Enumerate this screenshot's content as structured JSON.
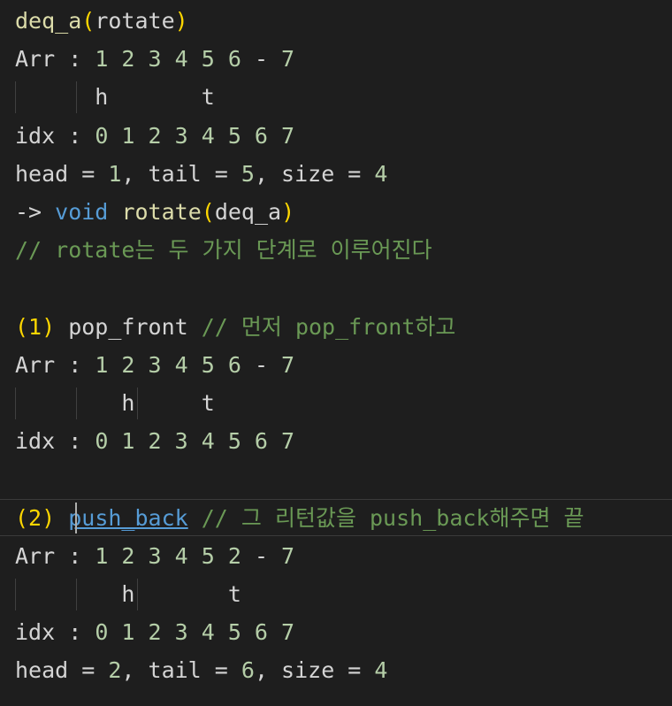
{
  "lines": [
    {
      "parts": [
        {
          "t": "deq_a",
          "c": "yellow"
        },
        {
          "t": "(",
          "c": "paren"
        },
        {
          "t": "rotate",
          "c": "plain"
        },
        {
          "t": ")",
          "c": "paren"
        }
      ]
    },
    {
      "parts": [
        {
          "t": "Arr : ",
          "c": "plain"
        },
        {
          "t": "1 2 3 4 5 6",
          "c": "num"
        },
        {
          "t": " - ",
          "c": "plain"
        },
        {
          "t": "7",
          "c": "num"
        }
      ]
    },
    {
      "parts": [
        {
          "t": "      h       t",
          "c": "plain"
        }
      ]
    },
    {
      "parts": [
        {
          "t": "idx : ",
          "c": "plain"
        },
        {
          "t": "0 1 2 3 4 5 6 7",
          "c": "num"
        }
      ]
    },
    {
      "parts": [
        {
          "t": "head = ",
          "c": "plain"
        },
        {
          "t": "1",
          "c": "num"
        },
        {
          "t": ", tail = ",
          "c": "plain"
        },
        {
          "t": "5",
          "c": "num"
        },
        {
          "t": ", size = ",
          "c": "plain"
        },
        {
          "t": "4",
          "c": "num"
        }
      ]
    },
    {
      "parts": [
        {
          "t": "-> ",
          "c": "plain"
        },
        {
          "t": "void",
          "c": "blue"
        },
        {
          "t": " ",
          "c": "plain"
        },
        {
          "t": "rotate",
          "c": "yellow"
        },
        {
          "t": "(",
          "c": "paren"
        },
        {
          "t": "deq_a",
          "c": "plain"
        },
        {
          "t": ")",
          "c": "paren"
        }
      ]
    },
    {
      "parts": [
        {
          "t": "// rotate는 두 가지 단계로 이루어진다",
          "c": "green"
        }
      ]
    },
    {
      "parts": [
        {
          "t": "",
          "c": "plain"
        }
      ]
    },
    {
      "parts": [
        {
          "t": "(1)",
          "c": "paren"
        },
        {
          "t": " pop_front ",
          "c": "plain"
        },
        {
          "t": "// 먼저 pop_front하고",
          "c": "green"
        }
      ]
    },
    {
      "parts": [
        {
          "t": "Arr : ",
          "c": "plain"
        },
        {
          "t": "1 2 3 4 5 6",
          "c": "num"
        },
        {
          "t": " - ",
          "c": "plain"
        },
        {
          "t": "7",
          "c": "num"
        }
      ]
    },
    {
      "parts": [
        {
          "t": "        h     t",
          "c": "plain"
        }
      ]
    },
    {
      "parts": [
        {
          "t": "idx : ",
          "c": "plain"
        },
        {
          "t": "0 1 2 3 4 5 6 7",
          "c": "num"
        }
      ]
    },
    {
      "parts": [
        {
          "t": "",
          "c": "plain"
        }
      ]
    },
    {
      "parts": [
        {
          "t": "(2)",
          "c": "paren"
        },
        {
          "t": " ",
          "c": "plain"
        },
        {
          "t": "push_back",
          "c": "link"
        },
        {
          "t": " ",
          "c": "plain"
        },
        {
          "t": "// 그 리턴값을 push_back해주면 끝",
          "c": "green"
        }
      ]
    },
    {
      "parts": [
        {
          "t": "Arr : ",
          "c": "plain"
        },
        {
          "t": "1 2 3 4 5 2",
          "c": "num"
        },
        {
          "t": " - ",
          "c": "plain"
        },
        {
          "t": "7",
          "c": "num"
        }
      ]
    },
    {
      "parts": [
        {
          "t": "        h       t",
          "c": "plain"
        }
      ]
    },
    {
      "parts": [
        {
          "t": "idx : ",
          "c": "plain"
        },
        {
          "t": "0 1 2 3 4 5 6 7",
          "c": "num"
        }
      ]
    },
    {
      "parts": [
        {
          "t": "head = ",
          "c": "plain"
        },
        {
          "t": "2",
          "c": "num"
        },
        {
          "t": ", tail = ",
          "c": "plain"
        },
        {
          "t": "6",
          "c": "num"
        },
        {
          "t": ", size = ",
          "c": "plain"
        },
        {
          "t": "4",
          "c": "num"
        }
      ]
    }
  ]
}
